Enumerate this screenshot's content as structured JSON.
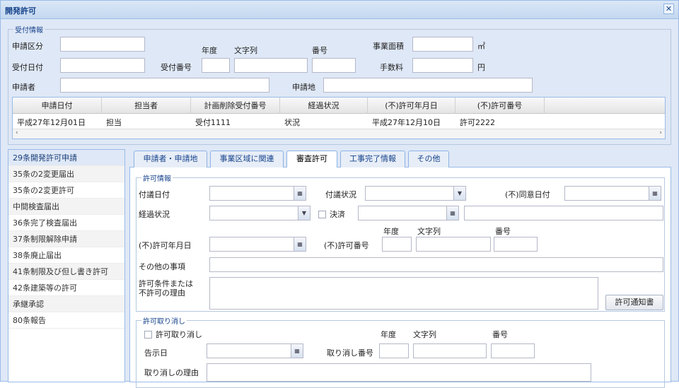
{
  "window": {
    "title": "開発許可",
    "close_icon": "close-icon"
  },
  "reception": {
    "legend": "受付情報",
    "labels": {
      "application_type": "申請区分",
      "reception_date": "受付日付",
      "reception_number": "受付番号",
      "applicant": "申請者",
      "application_site": "申請地",
      "fiscal_year": "年度",
      "string": "文字列",
      "number": "番号",
      "area": "事業面積",
      "fee": "手数料"
    },
    "units": {
      "area": "㎡",
      "fee": "円"
    },
    "values": {
      "application_type": "",
      "reception_date": "",
      "year": "",
      "string": "",
      "number": "",
      "applicant": "",
      "application_site": "",
      "area": "",
      "fee": ""
    }
  },
  "history_grid": {
    "columns": [
      "申請日付",
      "担当者",
      "計画削除受付番号",
      "経過状況",
      "(不)許可年月日",
      "(不)許可番号"
    ],
    "rows": [
      [
        "平成27年12月01日",
        "担当",
        "受付1111",
        "状況",
        "平成27年12月10日",
        "許可2222"
      ]
    ]
  },
  "sidebar": {
    "items": [
      "29条開発許可申請",
      "35条の2変更届出",
      "35条の2変更許可",
      "中間検査届出",
      "36条完了検査届出",
      "37条制限解除申請",
      "38条廃止届出",
      "41条制限及び但し書き許可",
      "42条建築等の許可",
      "承継承認",
      "80条報告"
    ],
    "selected_index": 0
  },
  "tabs": [
    "申請者・申請地",
    "事業区域に関連",
    "審査許可",
    "工事完了情報",
    "その他"
  ],
  "active_tab": 2,
  "permission": {
    "legend": "許可情報",
    "labels": {
      "inquiry_date": "付議日付",
      "inquiry_status": "付議状況",
      "consent_date": "(不)同意日付",
      "progress": "経過状況",
      "decision": "決済",
      "year": "年度",
      "string": "文字列",
      "number": "番号",
      "permit_date": "(不)許可年月日",
      "permit_number": "(不)許可番号",
      "other": "その他の事項",
      "conditions": "許可条件または\n不許可の理由"
    },
    "notice_button": "許可通知書"
  },
  "revocation": {
    "legend": "許可取り消し",
    "checkbox_label": "許可取り消し",
    "labels": {
      "notice_date": "告示日",
      "revocation_number": "取り消し番号",
      "reason": "取り消しの理由",
      "year": "年度",
      "string": "文字列",
      "number": "番号"
    }
  },
  "colors": {
    "window_bg": "#dfe8f6",
    "border": "#99bbe8",
    "title_text": "#15428b"
  }
}
